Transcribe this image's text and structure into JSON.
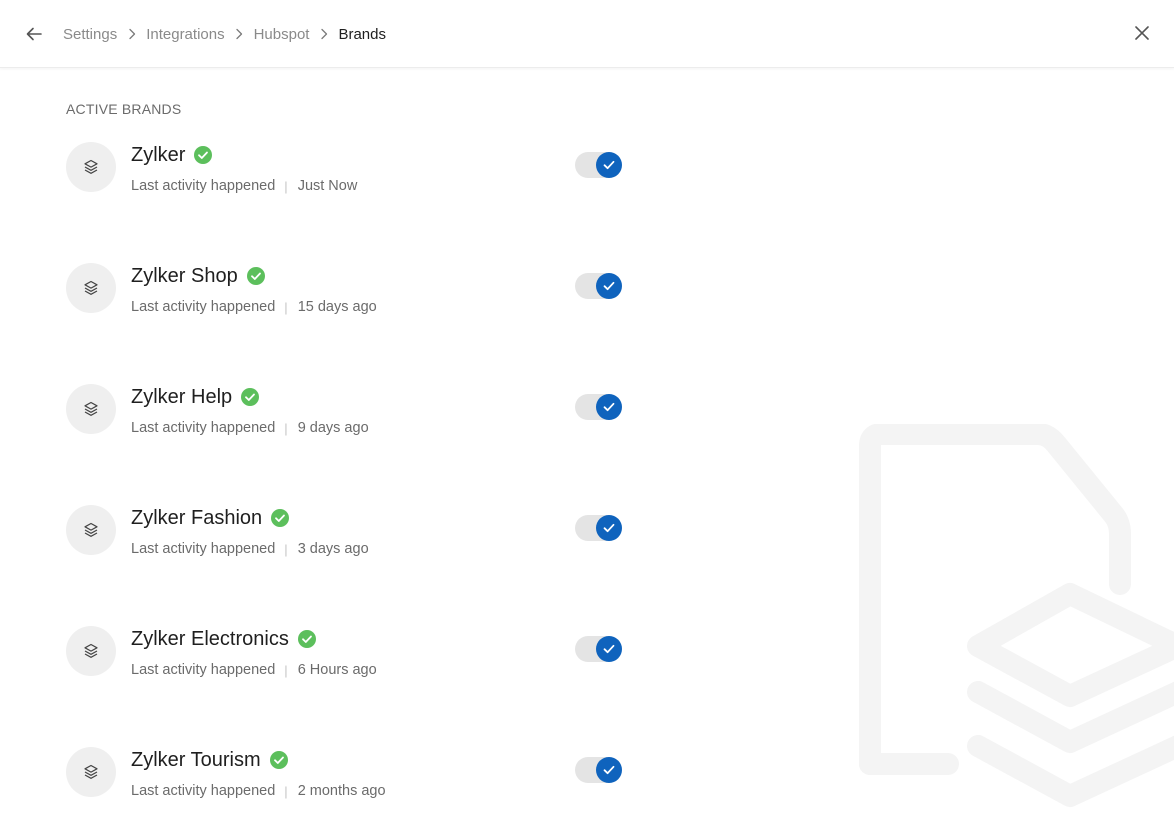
{
  "breadcrumb": {
    "items": [
      "Settings",
      "Integrations",
      "Hubspot"
    ],
    "current": "Brands"
  },
  "section": {
    "title": "ACTIVE BRANDS"
  },
  "brands": [
    {
      "name": "Zylker",
      "activity_label": "Last activity happened",
      "last_activity": "Just Now",
      "enabled": true
    },
    {
      "name": "Zylker Shop",
      "activity_label": "Last activity happened",
      "last_activity": "15 days ago",
      "enabled": true
    },
    {
      "name": "Zylker Help",
      "activity_label": "Last activity happened",
      "last_activity": "9 days ago",
      "enabled": true
    },
    {
      "name": "Zylker Fashion",
      "activity_label": "Last activity happened",
      "last_activity": "3 days ago",
      "enabled": true
    },
    {
      "name": "Zylker Electronics",
      "activity_label": "Last activity happened",
      "last_activity": "6 Hours ago",
      "enabled": true
    },
    {
      "name": "Zylker Tourism",
      "activity_label": "Last activity happened",
      "last_activity": "2 months ago",
      "enabled": true
    }
  ],
  "icons": {
    "back": "arrow-left-icon",
    "close": "close-icon",
    "separator": "chevron-right-icon",
    "brand": "layers-icon",
    "verified": "check-circle-icon",
    "toggle": "check-icon",
    "watermark": "document-layers-illustration"
  },
  "colors": {
    "accent": "#0f63bd",
    "verified": "#5cbf5c",
    "muted_text": "#8a8a8a",
    "track": "#e4e4e4"
  }
}
